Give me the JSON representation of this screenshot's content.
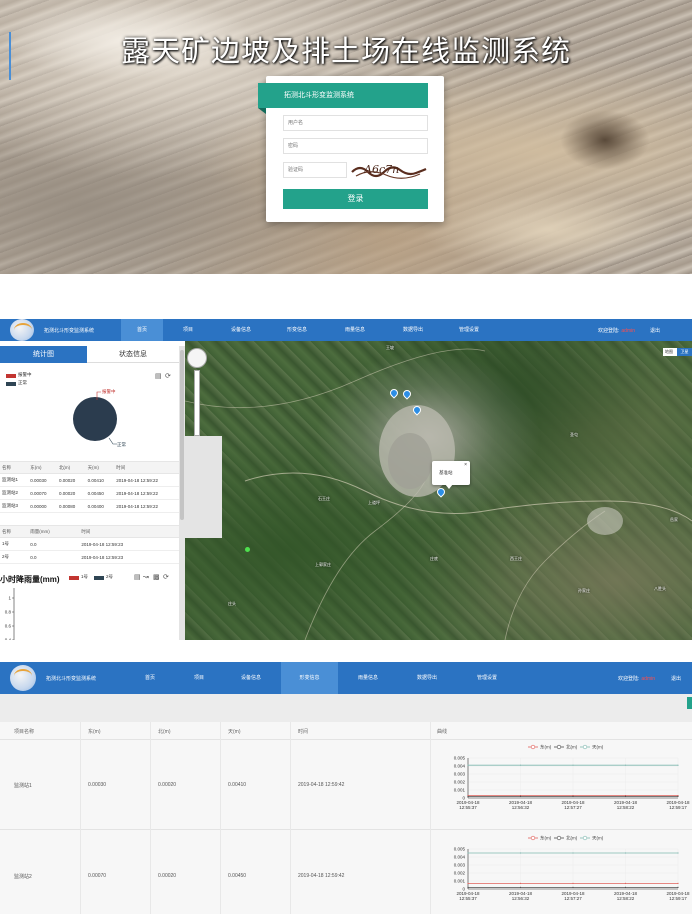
{
  "login": {
    "title": "露天矿边坡及排土场在线监测系统",
    "banner": "拓测北斗形变监测系统",
    "username_placeholder": "用户名",
    "password_placeholder": "密码",
    "captcha_placeholder": "验证码",
    "captcha_text": "A6c7n",
    "submit_label": "登录"
  },
  "nav": {
    "brand": "拓测北斗形变监测系统",
    "items": [
      "首页",
      "项目",
      "设备信息",
      "形变信息",
      "雨量信息",
      "数据导出",
      "管理设置"
    ],
    "welcome": "欢迎登陆:",
    "username": "admin",
    "logout": "退出"
  },
  "home": {
    "tabs": [
      "统计图",
      "状态信息"
    ],
    "legend": [
      {
        "label": "报警中",
        "color": "#c23531"
      },
      {
        "label": "正常",
        "color": "#2f4554"
      }
    ],
    "pie_labels": {
      "alarm": "报警中",
      "normal": "正常"
    },
    "deform_table": {
      "headers": [
        "名称",
        "东(m)",
        "北(m)",
        "天(m)",
        "时间"
      ],
      "rows": [
        [
          "监测站1",
          "0.00030",
          "0.00020",
          "0.00410",
          "2019-04-18 12:59:22"
        ],
        [
          "监测站2",
          "0.00070",
          "0.00020",
          "0.00450",
          "2019-04-18 12:59:22"
        ],
        [
          "监测站3",
          "0.00000",
          "0.00080",
          "0.00400",
          "2019-04-18 12:59:22"
        ]
      ]
    },
    "rain_table": {
      "headers": [
        "名称",
        "雨量(mm)",
        "时间"
      ],
      "rows": [
        [
          "1号",
          "0.0",
          "2019-04-18 12:59:23"
        ],
        [
          "2号",
          "0.0",
          "2019-04-18 12:59:23"
        ]
      ]
    },
    "rain_chart": {
      "title": "小时降雨量(mm)",
      "legend": [
        {
          "label": "1号",
          "color": "#c23531"
        },
        {
          "label": "2号",
          "color": "#2f4554"
        }
      ],
      "yticks": [
        "1",
        "0.8",
        "0.6",
        "0.4"
      ]
    },
    "map": {
      "type_labels": [
        "地图",
        "卫星"
      ],
      "popup_title": "基准站",
      "popup_close": "×",
      "labels": [
        "王坡",
        "圣屯",
        "上道坪",
        "石王庄",
        "西王庄",
        "上郭家庄",
        "庄底",
        "孙家庄",
        "庄头",
        "八胜头",
        "岳家"
      ]
    }
  },
  "deform": {
    "headers": [
      "项目名称",
      "东(m)",
      "北(m)",
      "天(m)",
      "时间",
      "曲线"
    ],
    "rows": [
      {
        "name": "监测站1",
        "east": "0.00030",
        "north": "0.00020",
        "up": "0.00410",
        "time": "2019-04-18 12:59:42"
      },
      {
        "name": "监测站2",
        "east": "0.00070",
        "north": "0.00020",
        "up": "0.00450",
        "time": "2019-04-18 12:59:42"
      }
    ]
  },
  "chart_data": [
    {
      "type": "line",
      "x": [
        "2019-04-18 12:55:37",
        "2019-04-18 12:56:32",
        "2019-04-18 12:57:27",
        "2019-04-18 12:58:22",
        "2019-04-18 12:59:17"
      ],
      "series": [
        {
          "name": "东(m)",
          "color": "#e0605a",
          "values": [
            0.0003,
            0.0003,
            0.0003,
            0.0003,
            0.0003
          ]
        },
        {
          "name": "北(m)",
          "color": "#4a4a4a",
          "values": [
            0.0002,
            0.0002,
            0.0002,
            0.0002,
            0.0002
          ]
        },
        {
          "name": "天(m)",
          "color": "#7fb8b0",
          "values": [
            0.0041,
            0.0041,
            0.0041,
            0.0041,
            0.0041
          ]
        }
      ],
      "yticks": [
        "0.005",
        "0.004",
        "0.003",
        "0.002",
        "0.001",
        "0"
      ],
      "ylim": [
        0,
        0.005
      ],
      "grid": true,
      "legend": "top-right"
    },
    {
      "type": "line",
      "x": [
        "2019-04-18 12:55:37",
        "2019-04-18 12:56:32",
        "2019-04-18 12:57:27",
        "2019-04-18 12:58:22",
        "2019-04-18 12:59:17"
      ],
      "series": [
        {
          "name": "东(m)",
          "color": "#e0605a",
          "values": [
            0.0007,
            0.0007,
            0.0007,
            0.0007,
            0.0007
          ]
        },
        {
          "name": "北(m)",
          "color": "#4a4a4a",
          "values": [
            0.0002,
            0.0002,
            0.0002,
            0.0002,
            0.0002
          ]
        },
        {
          "name": "天(m)",
          "color": "#7fb8b0",
          "values": [
            0.0045,
            0.0045,
            0.0045,
            0.0045,
            0.0045
          ]
        }
      ],
      "yticks": [
        "0.005",
        "0.004",
        "0.003",
        "0.002",
        "0.001",
        "0"
      ],
      "ylim": [
        0,
        0.005
      ],
      "grid": true,
      "legend": "top-right"
    }
  ]
}
